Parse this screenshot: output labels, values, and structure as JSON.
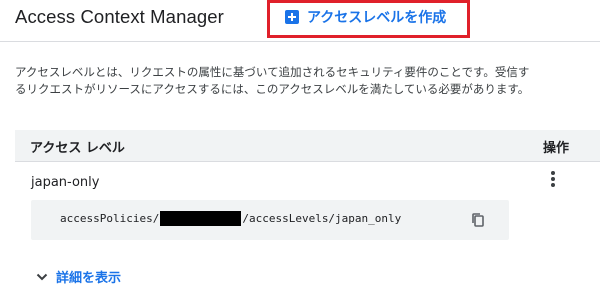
{
  "header": {
    "title": "Access Context Manager",
    "create_button": {
      "label": "アクセスレベルを作成",
      "icon": "add-box-icon"
    }
  },
  "description": "アクセスレベルとは、リクエストの属性に基づいて追加されるセキュリティ要件のことです。受信するリクエストがリソースにアクセスするには、このアクセスレベルを満たしている必要があります。",
  "table": {
    "columns": [
      "アクセス レベル",
      "操作"
    ],
    "rows": [
      {
        "name": "japan-only",
        "path_prefix": "accessPolicies/",
        "path_suffix": "/accessLevels/japan_only",
        "actions_icon": "more-vert-icon",
        "copy_icon": "copy-icon"
      }
    ]
  },
  "details_toggle": {
    "label": "詳細を表示",
    "icon": "chevron-down-icon"
  },
  "colors": {
    "accent": "#1a73e8",
    "highlight": "#e0202a",
    "header_bg": "#f1f3f4",
    "text": "#202124"
  }
}
